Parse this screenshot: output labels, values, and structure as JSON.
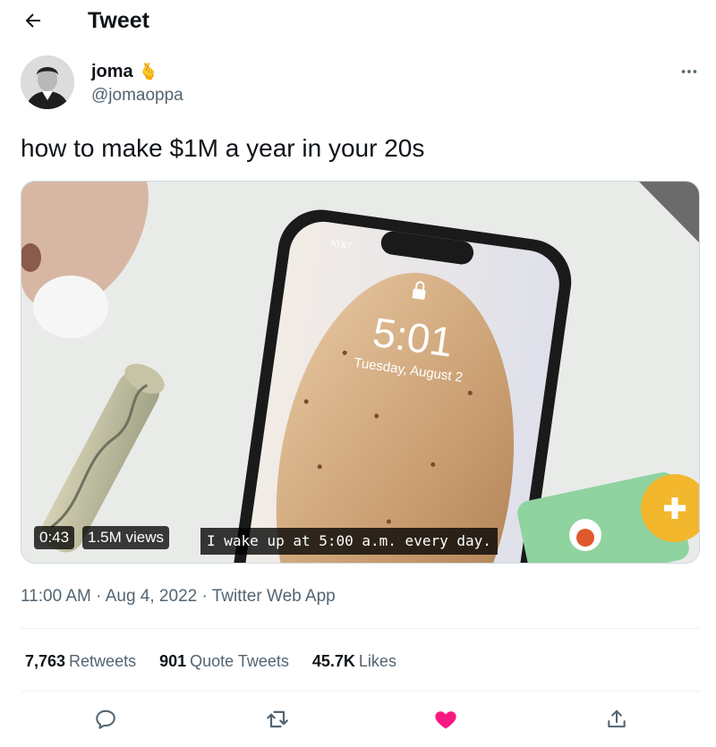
{
  "header": {
    "title": "Tweet",
    "back_icon": "arrow-left-icon"
  },
  "author": {
    "name": "joma",
    "badge_emoji": "🫰",
    "handle": "@jomaoppa"
  },
  "tweet": {
    "text": "how to make $1M a year in your 20s"
  },
  "media": {
    "duration": "0:43",
    "views": "1.5M views",
    "caption": "I wake up at 5:00 a.m. every day.",
    "phone_time": "5:01",
    "phone_date": "Tuesday, August 2",
    "phone_carrier": "AT&T"
  },
  "meta": {
    "time": "11:00 AM",
    "sep1": " · ",
    "date": "Aug 4, 2022",
    "sep2": " · ",
    "source": "Twitter Web App"
  },
  "stats": {
    "retweets": {
      "count": "7,763",
      "label": "Retweets"
    },
    "quotes": {
      "count": "901",
      "label": "Quote Tweets"
    },
    "likes": {
      "count": "45.7K",
      "label": "Likes"
    }
  },
  "actions": [
    "reply-icon",
    "retweet-icon",
    "like-icon",
    "share-icon"
  ],
  "colors": {
    "text": "#0f1419",
    "secondary": "#536471",
    "like": "#f91880",
    "divider": "#eff3f4"
  }
}
